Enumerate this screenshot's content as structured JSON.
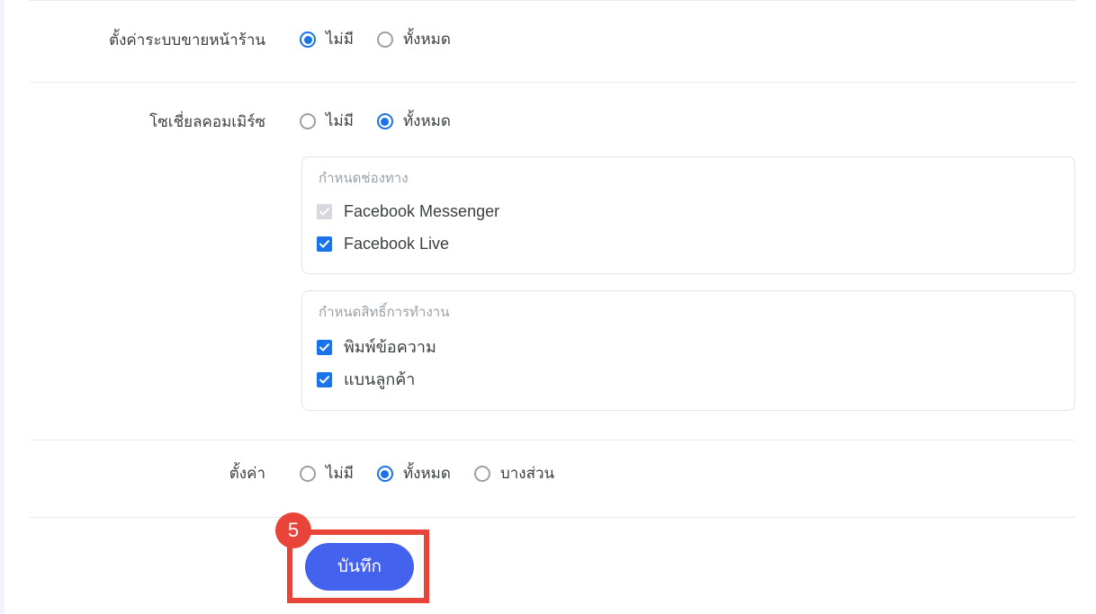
{
  "colors": {
    "accent_blue": "#1a73e8",
    "button_blue": "#4362ee",
    "annotation_red": "#e8443a",
    "text": "#3c4043",
    "muted": "#9aa0a6",
    "divider": "#eceaf1",
    "disabled_checkbox": "#d6d8dd",
    "page_background": "#f4f2fb"
  },
  "rows": [
    {
      "label": "ตั้งค่าระบบขายหน้าร้าน",
      "options": [
        {
          "label": "ไม่มี",
          "selected": true
        },
        {
          "label": "ทั้งหมด",
          "selected": false
        }
      ]
    },
    {
      "label": "โซเชี่ยลคอมเมิร์ซ",
      "options": [
        {
          "label": "ไม่มี",
          "selected": false
        },
        {
          "label": "ทั้งหมด",
          "selected": true
        }
      ]
    },
    {
      "label": "ตั้งค่า",
      "options": [
        {
          "label": "ไม่มี",
          "selected": false
        },
        {
          "label": "ทั้งหมด",
          "selected": true
        },
        {
          "label": "บางส่วน",
          "selected": false
        }
      ]
    }
  ],
  "fieldsets": [
    {
      "legend": "กำหนดช่องทาง",
      "items": [
        {
          "label": "Facebook Messenger",
          "checked": true,
          "disabled": true
        },
        {
          "label": "Facebook Live",
          "checked": true,
          "disabled": false
        }
      ]
    },
    {
      "legend": "กำหนดสิทธิ์การทำงาน",
      "items": [
        {
          "label": "พิมพ์ข้อความ",
          "checked": true,
          "disabled": false
        },
        {
          "label": "แบนลูกค้า",
          "checked": true,
          "disabled": false
        }
      ]
    }
  ],
  "footer": {
    "save_label": "บันทึก",
    "annotation_step": "5"
  }
}
